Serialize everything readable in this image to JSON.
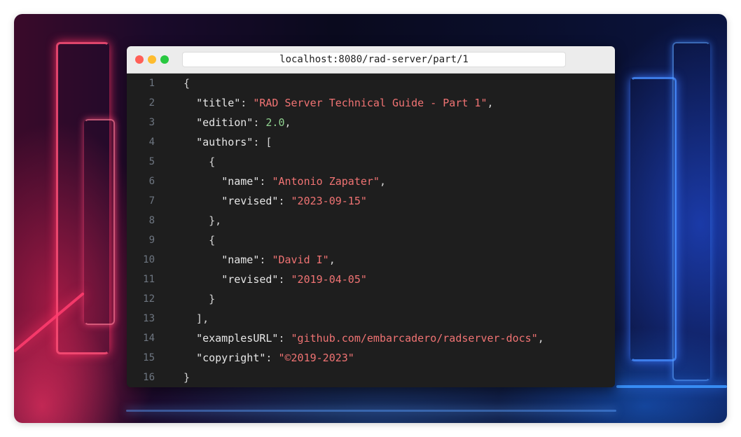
{
  "browser": {
    "url": "localhost:8080/rad-server/part/1"
  },
  "colors": {
    "key": "#e6e6e6",
    "string": "#f07373",
    "number": "#8fd18f",
    "punctuation": "#d4d4d4",
    "line_number": "#6e7681",
    "editor_bg": "#1e1e1e",
    "titlebar_bg": "#ececec"
  },
  "lines": [
    {
      "n": "1",
      "tokens": [
        {
          "t": "p",
          "v": "{"
        }
      ]
    },
    {
      "n": "2",
      "tokens": [
        {
          "t": "p",
          "v": "  "
        },
        {
          "t": "k",
          "v": "\"title\""
        },
        {
          "t": "p",
          "v": ": "
        },
        {
          "t": "s",
          "v": "\"RAD Server Technical Guide - Part 1\""
        },
        {
          "t": "p",
          "v": ","
        }
      ]
    },
    {
      "n": "3",
      "tokens": [
        {
          "t": "p",
          "v": "  "
        },
        {
          "t": "k",
          "v": "\"edition\""
        },
        {
          "t": "p",
          "v": ": "
        },
        {
          "t": "n",
          "v": "2.0"
        },
        {
          "t": "p",
          "v": ","
        }
      ]
    },
    {
      "n": "4",
      "tokens": [
        {
          "t": "p",
          "v": "  "
        },
        {
          "t": "k",
          "v": "\"authors\""
        },
        {
          "t": "p",
          "v": ": ["
        }
      ]
    },
    {
      "n": "5",
      "tokens": [
        {
          "t": "p",
          "v": "    {"
        }
      ]
    },
    {
      "n": "6",
      "tokens": [
        {
          "t": "p",
          "v": "      "
        },
        {
          "t": "k",
          "v": "\"name\""
        },
        {
          "t": "p",
          "v": ": "
        },
        {
          "t": "s",
          "v": "\"Antonio Zapater\""
        },
        {
          "t": "p",
          "v": ","
        }
      ]
    },
    {
      "n": "7",
      "tokens": [
        {
          "t": "p",
          "v": "      "
        },
        {
          "t": "k",
          "v": "\"revised\""
        },
        {
          "t": "p",
          "v": ": "
        },
        {
          "t": "s",
          "v": "\"2023-09-15\""
        }
      ]
    },
    {
      "n": "8",
      "tokens": [
        {
          "t": "p",
          "v": "    },"
        }
      ]
    },
    {
      "n": "9",
      "tokens": [
        {
          "t": "p",
          "v": "    {"
        }
      ]
    },
    {
      "n": "10",
      "tokens": [
        {
          "t": "p",
          "v": "      "
        },
        {
          "t": "k",
          "v": "\"name\""
        },
        {
          "t": "p",
          "v": ": "
        },
        {
          "t": "s",
          "v": "\"David I\""
        },
        {
          "t": "p",
          "v": ","
        }
      ]
    },
    {
      "n": "11",
      "tokens": [
        {
          "t": "p",
          "v": "      "
        },
        {
          "t": "k",
          "v": "\"revised\""
        },
        {
          "t": "p",
          "v": ": "
        },
        {
          "t": "s",
          "v": "\"2019-04-05\""
        }
      ]
    },
    {
      "n": "12",
      "tokens": [
        {
          "t": "p",
          "v": "    }"
        }
      ]
    },
    {
      "n": "13",
      "tokens": [
        {
          "t": "p",
          "v": "  ],"
        }
      ]
    },
    {
      "n": "14",
      "tokens": [
        {
          "t": "p",
          "v": "  "
        },
        {
          "t": "k",
          "v": "\"examplesURL\""
        },
        {
          "t": "p",
          "v": ": "
        },
        {
          "t": "s",
          "v": "\"github.com/embarcadero/radserver-docs\""
        },
        {
          "t": "p",
          "v": ","
        }
      ]
    },
    {
      "n": "15",
      "tokens": [
        {
          "t": "p",
          "v": "  "
        },
        {
          "t": "k",
          "v": "\"copyright\""
        },
        {
          "t": "p",
          "v": ": "
        },
        {
          "t": "s",
          "v": "\"©2019-2023\""
        }
      ]
    },
    {
      "n": "16",
      "tokens": [
        {
          "t": "p",
          "v": "}"
        }
      ]
    }
  ]
}
